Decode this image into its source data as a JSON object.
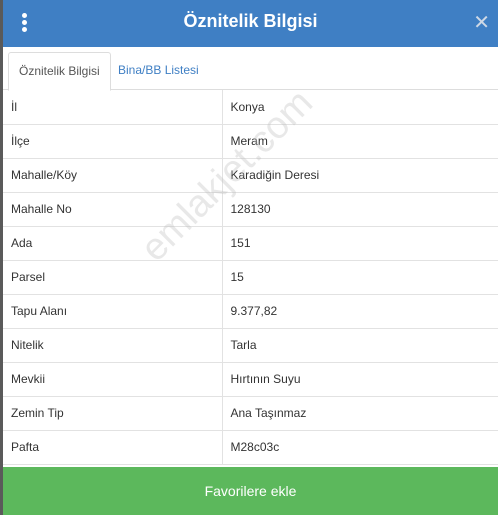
{
  "header": {
    "title": "Öznitelik Bilgisi",
    "close": "✕"
  },
  "tabs": [
    {
      "label": "Öznitelik Bilgisi",
      "active": true
    },
    {
      "label": "Bina/BB Listesi",
      "active": false
    }
  ],
  "attributes": [
    {
      "key": "İl",
      "value": "Konya"
    },
    {
      "key": "İlçe",
      "value": "Meram"
    },
    {
      "key": "Mahalle/Köy",
      "value": "Karadiğin Deresi"
    },
    {
      "key": "Mahalle No",
      "value": "128130"
    },
    {
      "key": "Ada",
      "value": "151"
    },
    {
      "key": "Parsel",
      "value": "15"
    },
    {
      "key": "Tapu Alanı",
      "value": "9.377,82"
    },
    {
      "key": "Nitelik",
      "value": "Tarla"
    },
    {
      "key": "Mevkii",
      "value": "Hırtının Suyu"
    },
    {
      "key": "Zemin Tip",
      "value": "Ana Taşınmaz"
    },
    {
      "key": "Pafta",
      "value": "M28c03c"
    }
  ],
  "footer": {
    "favorite_label": "Favorilere ekle"
  },
  "watermark": "emlakjet.com",
  "colors": {
    "header": "#3f7fc4",
    "favorite": "#5cb85c"
  }
}
